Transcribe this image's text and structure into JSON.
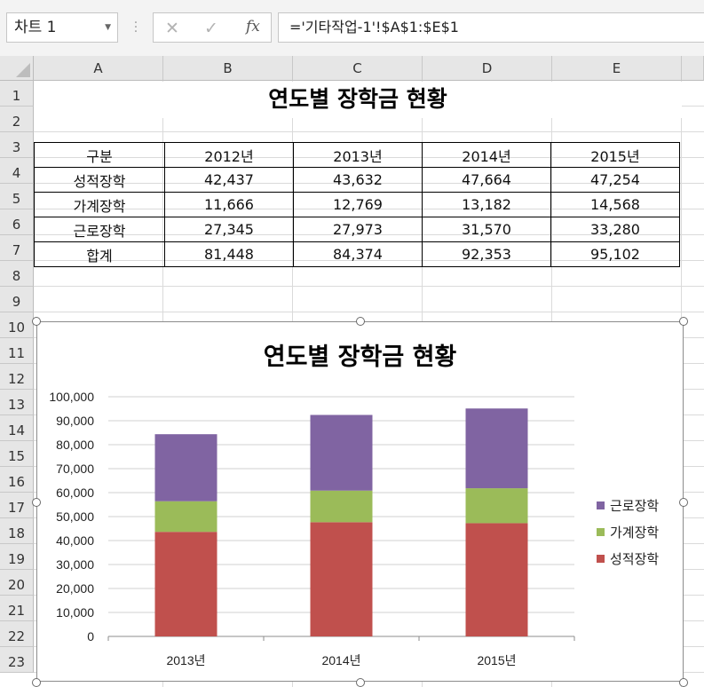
{
  "formula_bar": {
    "name_box": "차트 1",
    "cancel_icon": "✕",
    "enter_icon": "✓",
    "fx_label": "fx",
    "formula": "='기타작업-1'!$A$1:$E$1"
  },
  "columns": [
    "A",
    "B",
    "C",
    "D",
    "E"
  ],
  "rows": [
    "1",
    "2",
    "3",
    "4",
    "5",
    "6",
    "7",
    "8",
    "9",
    "10",
    "11",
    "12",
    "13",
    "14",
    "15",
    "16",
    "17",
    "18",
    "19",
    "20",
    "21",
    "22",
    "23"
  ],
  "sheet": {
    "title": "연도별 장학금 현황",
    "table": {
      "header": [
        "구분",
        "2012년",
        "2013년",
        "2014년",
        "2015년"
      ],
      "rows": [
        [
          "성적장학",
          "42,437",
          "43,632",
          "47,664",
          "47,254"
        ],
        [
          "가계장학",
          "11,666",
          "12,769",
          "13,182",
          "14,568"
        ],
        [
          "근로장학",
          "27,345",
          "27,973",
          "31,570",
          "33,280"
        ],
        [
          "합계",
          "81,448",
          "84,374",
          "92,353",
          "95,102"
        ]
      ]
    }
  },
  "chart_data": {
    "type": "bar",
    "stacked": true,
    "title": "연도별 장학금 현황",
    "categories": [
      "2013년",
      "2014년",
      "2015년"
    ],
    "series": [
      {
        "name": "성적장학",
        "values": [
          43632,
          47664,
          47254
        ],
        "color": "#c0504d"
      },
      {
        "name": "가계장학",
        "values": [
          12769,
          13182,
          14568
        ],
        "color": "#9bbb59"
      },
      {
        "name": "근로장학",
        "values": [
          27973,
          31570,
          33280
        ],
        "color": "#8064a2"
      }
    ],
    "ylim": [
      0,
      100000
    ],
    "yticks": [
      "0",
      "10,000",
      "20,000",
      "30,000",
      "40,000",
      "50,000",
      "60,000",
      "70,000",
      "80,000",
      "90,000",
      "100,000"
    ],
    "grid": true,
    "legend_position": "right",
    "legend_order": [
      "근로장학",
      "가계장학",
      "성적장학"
    ]
  }
}
